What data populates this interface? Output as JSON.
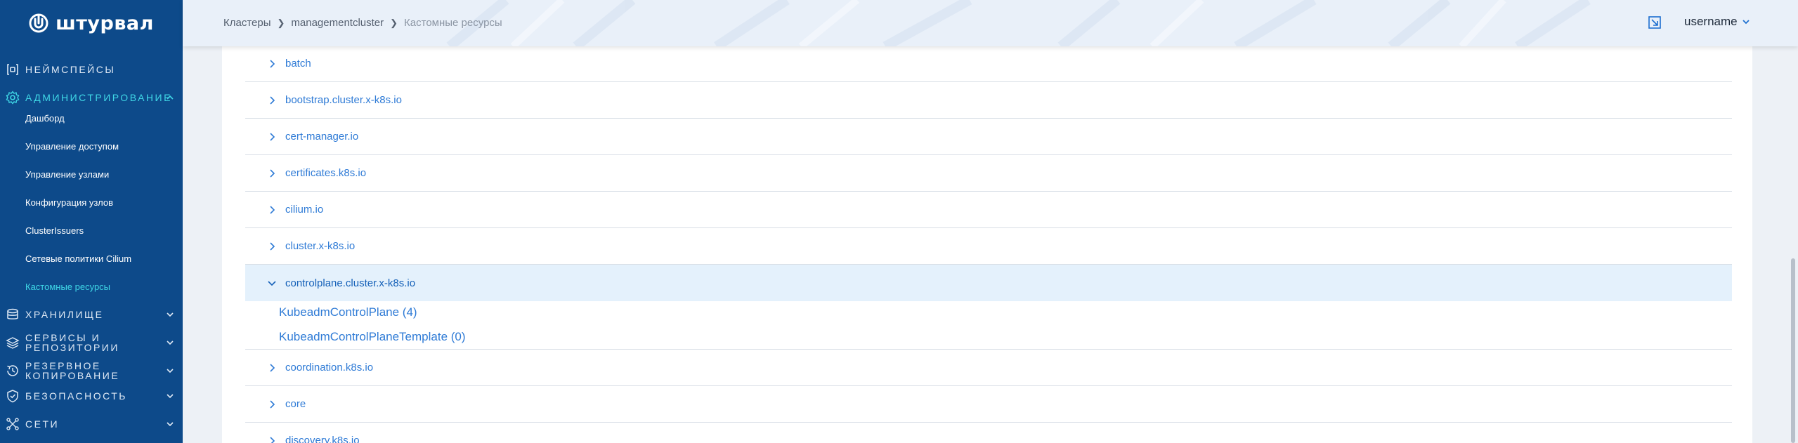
{
  "brand": {
    "name": "штурвал"
  },
  "sidebar": {
    "sections": [
      {
        "label": "Неймспейсы",
        "icon": "namespace-icon"
      },
      {
        "label": "Администрирование",
        "icon": "gear-icon",
        "expanded": true
      },
      {
        "label": "Хранилище",
        "icon": "database-icon"
      },
      {
        "label": "Сервисы и репозитории",
        "line1": "Сервисы и",
        "line2": "репозитории",
        "icon": "stack-icon"
      },
      {
        "label": "Резервное копирование",
        "line1": "Резервное",
        "line2": "копирование",
        "icon": "backup-icon"
      },
      {
        "label": "Безопасность",
        "icon": "shield-icon"
      },
      {
        "label": "Сети",
        "icon": "network-icon"
      }
    ],
    "admin_items": [
      {
        "label": "Дашборд"
      },
      {
        "label": "Управление доступом"
      },
      {
        "label": "Управление узлами"
      },
      {
        "label": "Конфигурация узлов"
      },
      {
        "label": "ClusterIssuers"
      },
      {
        "label": "Сетевые политики Cilium"
      },
      {
        "label": "Кастомные ресурсы",
        "active": true
      }
    ]
  },
  "header": {
    "breadcrumbs": [
      "Кластеры",
      "managementcluster",
      "Кастомные ресурсы"
    ],
    "username": "username"
  },
  "groups": [
    {
      "name": "batch"
    },
    {
      "name": "bootstrap.cluster.x-k8s.io"
    },
    {
      "name": "cert-manager.io"
    },
    {
      "name": "certificates.k8s.io"
    },
    {
      "name": "cilium.io"
    },
    {
      "name": "cluster.x-k8s.io"
    },
    {
      "name": "controlplane.cluster.x-k8s.io",
      "expanded": true,
      "resources": [
        {
          "label": "KubeadmControlPlane (4)"
        },
        {
          "label": "KubeadmControlPlaneTemplate (0)"
        }
      ]
    },
    {
      "name": "coordination.k8s.io"
    },
    {
      "name": "core"
    },
    {
      "name": "discovery.k8s.io"
    }
  ],
  "colors": {
    "sidebar_bg": "#0d4a8a",
    "accent": "#3fd7e6",
    "link": "#2f7bd6",
    "selected_row": "#e4f1fc"
  }
}
